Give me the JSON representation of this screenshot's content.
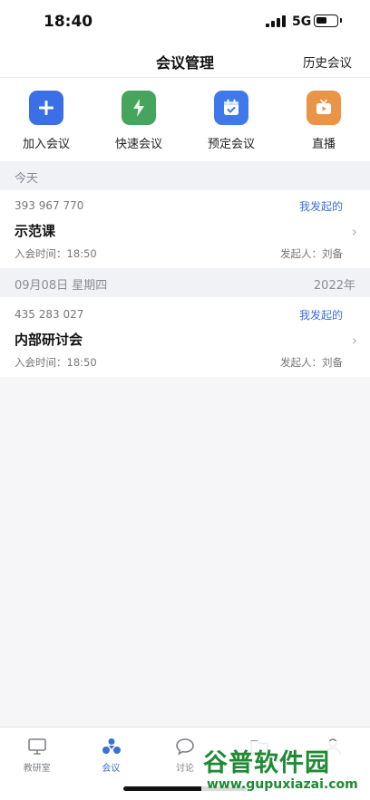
{
  "status": {
    "time": "18:40",
    "network": "5G"
  },
  "header": {
    "title": "会议管理",
    "right_link": "历史会议"
  },
  "actions": [
    {
      "label": "加入会议",
      "icon": "plus-icon",
      "color": "#3b6fe6"
    },
    {
      "label": "快速会议",
      "icon": "lightning-icon",
      "color": "#46a55c"
    },
    {
      "label": "预定会议",
      "icon": "calendar-icon",
      "color": "#3f78e8"
    },
    {
      "label": "直播",
      "icon": "tv-icon",
      "color": "#e99447"
    }
  ],
  "sections": [
    {
      "date_label": "今天",
      "year_label": "",
      "meetings": [
        {
          "id": "393 967 770",
          "tag": "我发起的",
          "title": "示范课",
          "time": "入会时间：18:50",
          "host": "发起人：刘备"
        }
      ]
    },
    {
      "date_label": "09月08日 星期四",
      "year_label": "2022年",
      "meetings": [
        {
          "id": "435 283 027",
          "tag": "我发起的",
          "title": "内部研讨会",
          "time": "入会时间：18:50",
          "host": "发起人：刘备"
        }
      ]
    }
  ],
  "tabbar": {
    "active": 1,
    "items": [
      {
        "label": "教研室",
        "icon": "monitor-icon"
      },
      {
        "label": "会议",
        "icon": "meeting-icon"
      },
      {
        "label": "讨论",
        "icon": "chat-bubble-icon"
      },
      {
        "label": "",
        "icon": "folder-icon"
      },
      {
        "label": "",
        "icon": "profile-icon"
      }
    ]
  },
  "watermark": {
    "logo_text": "谷普软件园",
    "url": "www.gupuxiazai.com"
  },
  "colors": {
    "accent": "#3b6fd8",
    "section_bg": "#f1f2f5",
    "watermark": "#1f8a33"
  }
}
